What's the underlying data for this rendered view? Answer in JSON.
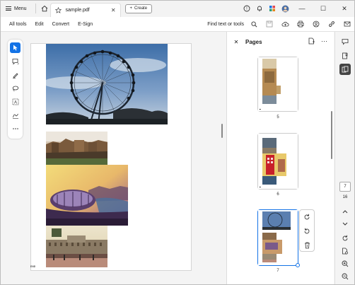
{
  "titlebar": {
    "menu_label": "Menu",
    "tab_title": "sample.pdf",
    "create_label": "Create"
  },
  "menubar": {
    "items": [
      "All tools",
      "Edit",
      "Convert",
      "E-Sign"
    ],
    "find_label": "Find text or tools"
  },
  "document": {
    "end_label": "END"
  },
  "pages_panel": {
    "title": "Pages",
    "thumbnails": [
      {
        "number": "5"
      },
      {
        "number": "6"
      },
      {
        "number": "7"
      }
    ]
  },
  "page_nav": {
    "current_page": "7",
    "total_pages": "16"
  },
  "colors": {
    "accent": "#1473e6",
    "selected_thumb_border": "#1473e6"
  }
}
